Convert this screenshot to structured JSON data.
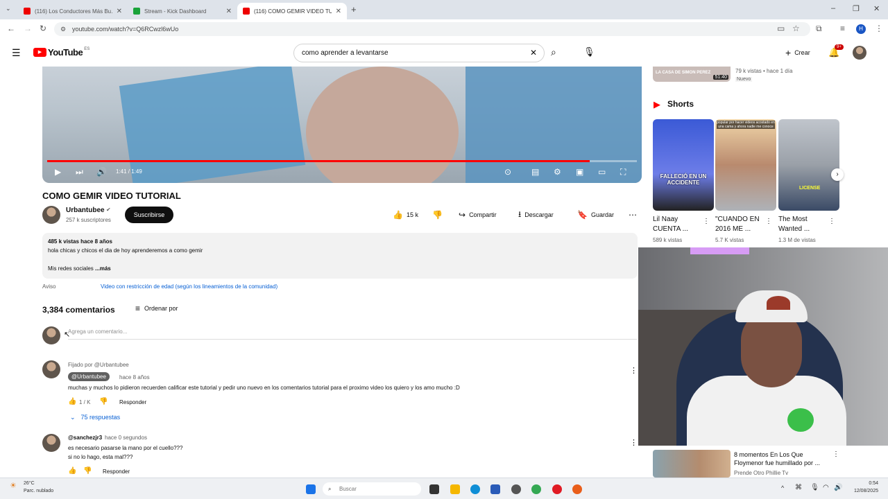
{
  "browser": {
    "tabs": [
      {
        "title": "(116) Los Conductores Más Bu…",
        "active": false
      },
      {
        "title": "Stream - Kick Dashboard",
        "active": false
      },
      {
        "title": "(116) COMO GEMIR VIDEO TUT…",
        "active": true
      }
    ],
    "new_tab": "+",
    "url": "youtube.com/watch?v=Q6RCwzl6wUo",
    "profile_initial": "H"
  },
  "youtube": {
    "logo": "YouTube",
    "logo_region": "ES",
    "search_value": "como aprender a levantarse",
    "create_label": "Crear",
    "notif_count": "9+"
  },
  "video": {
    "time": "1:41 / 1:49",
    "progress": 0.92,
    "title": "COMO GEMIR VIDEO TUTORIAL",
    "channel": "Urbantubee",
    "subscribers": "257 k suscriptores",
    "subscribe_label": "Suscribirse",
    "likes": "15 k",
    "share_label": "Compartir",
    "download_label": "Descargar",
    "save_label": "Guardar"
  },
  "description": {
    "stats": "485 k vistas  hace 8 años",
    "line1": "hola chicas y chicos el dia de hoy aprenderemos a como gemir",
    "line2": "Mis redes sociales",
    "more": "...más"
  },
  "notice": {
    "label": "Aviso",
    "text": "Video con restricción de edad (según los lineamientos de la comunidad)"
  },
  "comments": {
    "count": "3,384 comentarios",
    "sort_label": "Ordenar por",
    "add_placeholder": "Agrega un comentario...",
    "items": [
      {
        "pinned": "Fijado por @Urbantubee",
        "author": "@Urbantubee",
        "age": "hace 8 años",
        "text": "muchas y muchos lo pidieron recuerden calificar este tutorial y pedir uno nuevo en los comentarios tutorial para el  proximo video los quiero y los amo mucho :D",
        "likes": "1 / K",
        "reply_label": "Responder",
        "replies": "75 respuestas"
      },
      {
        "author": "@sanchezjr3",
        "age": "hace 0 segundos",
        "text1": "es necesario pasarse la mano por el cuello???",
        "text2": "si no lo hago, esta mal???",
        "reply_label": "Responder"
      }
    ]
  },
  "sidebar": {
    "top_item": {
      "duration": "51:40",
      "meta": "79 k vistas • hace 1 día",
      "badge": "Nuevo",
      "thumb_text": "LA CASA DE SIMON PEREZ"
    },
    "shorts_title": "Shorts",
    "shorts": [
      {
        "title": "Lil Naay CUENTA ...",
        "views": "589 k vistas",
        "overlay": "FALLECIÓ EN UN ACCIDENTE"
      },
      {
        "title": "\"CUANDO EN 2016 ME ...",
        "views": "5.7 K vistas",
        "overlay": "popular por hacer videos acostado en una cama y ahora nadie me conoce"
      },
      {
        "title": "The Most Wanted ...",
        "views": "1.3 M de vistas",
        "overlay": "LICENSE"
      }
    ],
    "bottom_item": {
      "title": "8 momentos En Los Que Floymenor fue humillado por ...",
      "channel": "Prende Otro Phillie Tv"
    }
  },
  "taskbar": {
    "weather_temp": "26°C",
    "weather_text": "Parc. nublado",
    "search_placeholder": "Buscar",
    "time": "0:54",
    "date": "12/08/2025"
  }
}
